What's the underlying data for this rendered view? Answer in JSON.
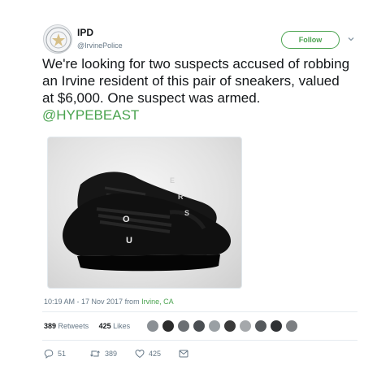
{
  "user": {
    "name": "IPD",
    "handle": "@IrvinePolice"
  },
  "follow_button": {
    "label": "Follow"
  },
  "tweet": {
    "text": "We're looking for two suspects accused of robbing an Irvine resident of this pair of sneakers, valued at $6,000. One suspect was armed.",
    "mention": "@HYPEBEAST",
    "media_shoe_letters_left": [
      "O",
      "U"
    ],
    "media_shoe_letters_right": [
      "E",
      "R",
      "S"
    ]
  },
  "meta": {
    "time": "10:19 AM - 17 Nov 2017 from",
    "location": "Irvine, CA"
  },
  "stats": {
    "retweets_count": "389",
    "retweets_label": "Retweets",
    "likes_count": "425",
    "likes_label": "Likes"
  },
  "likers_colors": [
    "#8a8f94",
    "#2b2b2b",
    "#6b6f73",
    "#4a4e52",
    "#9aa0a4",
    "#3a3a3a",
    "#a5a8ab",
    "#55595c",
    "#2f3134",
    "#7c7f82"
  ],
  "actions": {
    "reply_count": "51",
    "retweet_count": "389",
    "like_count": "425"
  },
  "colors": {
    "accent": "#4aa34f",
    "muted": "#657786",
    "text": "#14171a"
  }
}
